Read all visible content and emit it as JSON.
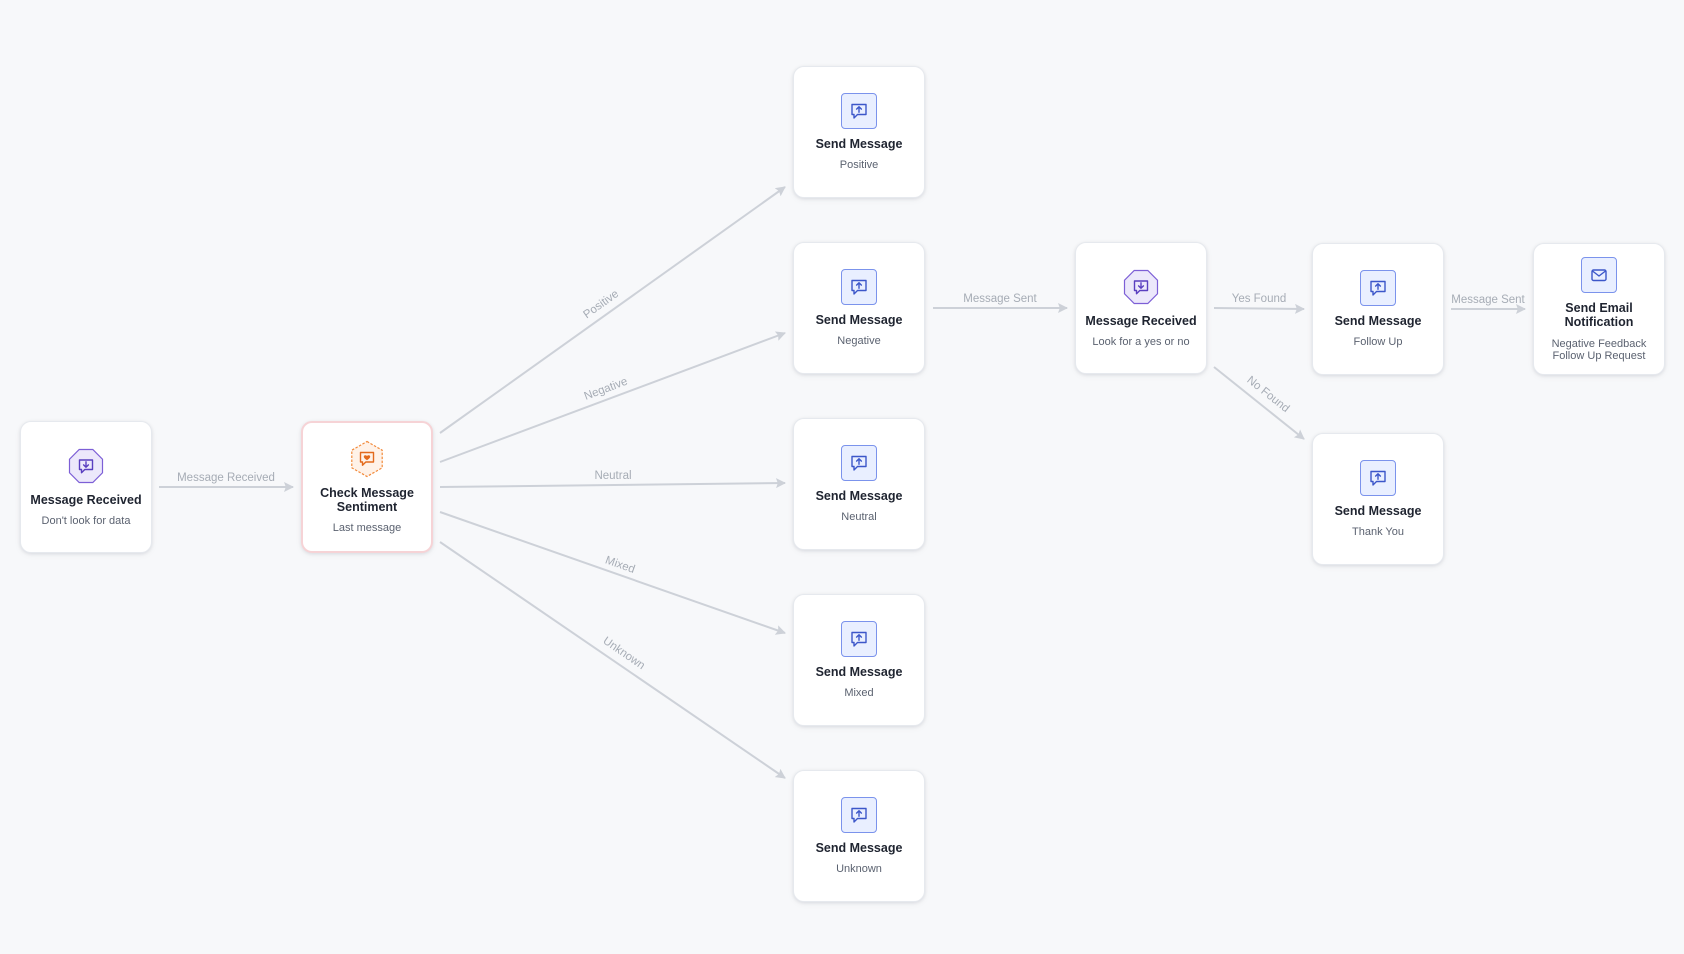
{
  "colors": {
    "background": "#f7f8fa",
    "edge": "#cdd1d8",
    "edge_label": "#a6acb5",
    "send_icon_fill": "#e9efff",
    "send_icon_stroke": "#4f6ad8",
    "receive_icon_fill": "#ece8fb",
    "receive_icon_stroke": "#7d5fd6",
    "sentiment_icon_fill": "#fff2e8",
    "sentiment_icon_stroke": "#f28a3b",
    "highlight_border": "#f6d3d6"
  },
  "nodes": {
    "received_initial": {
      "icon": "message-received-icon",
      "title": "Message Received",
      "subtitle": "Don't look for data"
    },
    "check_sentiment": {
      "icon": "sentiment-icon",
      "title": "Check Message Sentiment",
      "subtitle": "Last message"
    },
    "send_positive": {
      "icon": "send-message-icon",
      "title": "Send Message",
      "subtitle": "Positive"
    },
    "send_negative": {
      "icon": "send-message-icon",
      "title": "Send Message",
      "subtitle": "Negative"
    },
    "send_neutral": {
      "icon": "send-message-icon",
      "title": "Send Message",
      "subtitle": "Neutral"
    },
    "send_mixed": {
      "icon": "send-message-icon",
      "title": "Send Message",
      "subtitle": "Mixed"
    },
    "send_unknown": {
      "icon": "send-message-icon",
      "title": "Send Message",
      "subtitle": "Unknown"
    },
    "received_yes_no": {
      "icon": "message-received-icon",
      "title": "Message Received",
      "subtitle": "Look for a yes or no"
    },
    "send_follow_up": {
      "icon": "send-message-icon",
      "title": "Send Message",
      "subtitle": "Follow Up"
    },
    "send_thank_you": {
      "icon": "send-message-icon",
      "title": "Send Message",
      "subtitle": "Thank You"
    },
    "send_email": {
      "icon": "email-icon",
      "title": "Send Email Notification",
      "subtitle": "Negative Feedback Follow Up Request"
    }
  },
  "edges": [
    {
      "from": "received_initial",
      "to": "check_sentiment",
      "label": "Message Received"
    },
    {
      "from": "check_sentiment",
      "to": "send_positive",
      "label": "Positive"
    },
    {
      "from": "check_sentiment",
      "to": "send_negative",
      "label": "Negative"
    },
    {
      "from": "check_sentiment",
      "to": "send_neutral",
      "label": "Neutral"
    },
    {
      "from": "check_sentiment",
      "to": "send_mixed",
      "label": "Mixed"
    },
    {
      "from": "check_sentiment",
      "to": "send_unknown",
      "label": "Unknown"
    },
    {
      "from": "send_negative",
      "to": "received_yes_no",
      "label": "Message Sent"
    },
    {
      "from": "received_yes_no",
      "to": "send_follow_up",
      "label": "Yes Found"
    },
    {
      "from": "received_yes_no",
      "to": "send_thank_you",
      "label": "No Found"
    },
    {
      "from": "send_follow_up",
      "to": "send_email",
      "label": "Message Sent"
    }
  ]
}
